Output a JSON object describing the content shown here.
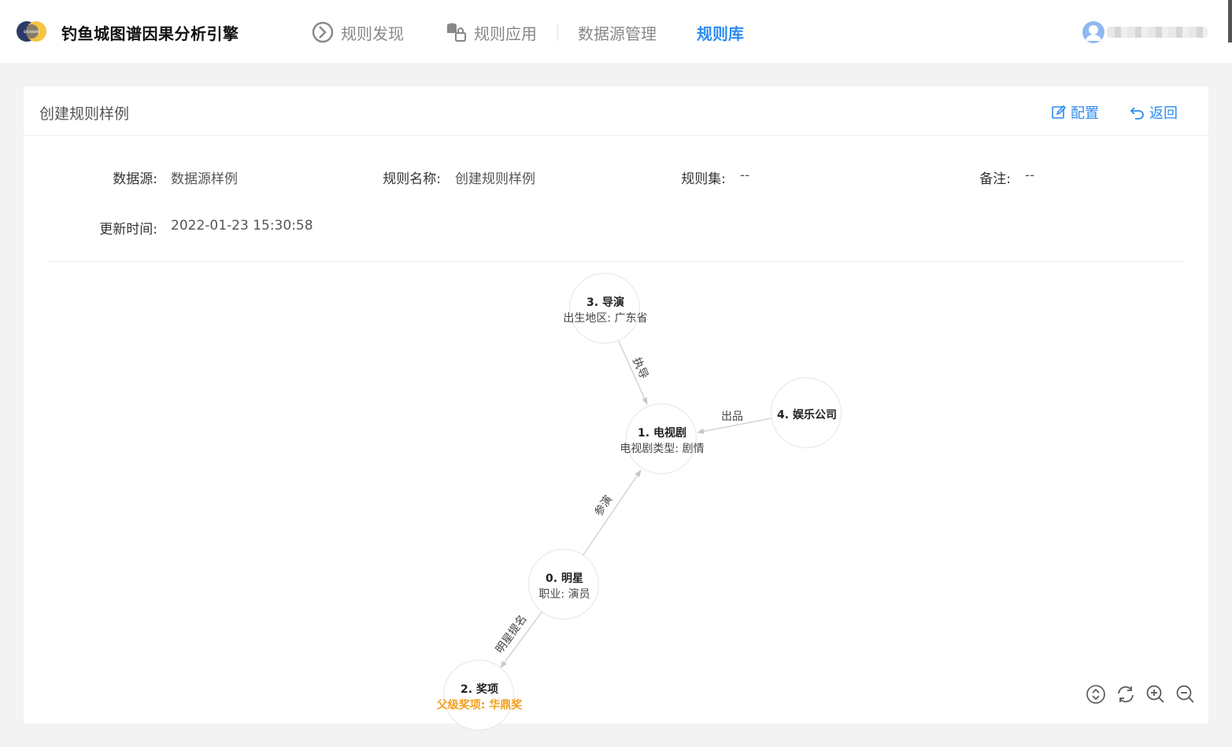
{
  "app": {
    "title": "钓鱼城图谱因果分析引擎",
    "logo_icon": "shenwan-logo"
  },
  "nav": {
    "items": [
      {
        "label": "规则发现",
        "icon": "play-circle-icon",
        "active": false
      },
      {
        "label": "规则应用",
        "icon": "database-lock-icon",
        "active": false
      },
      {
        "label": "数据源管理",
        "active": false
      },
      {
        "label": "规则库",
        "active": true
      }
    ]
  },
  "colors": {
    "accent": "#2d8cf0",
    "warn": "#f0a020"
  },
  "page": {
    "title": "创建规则样例",
    "config_label": "配置",
    "back_label": "返回"
  },
  "info": {
    "datasource_label": "数据源:",
    "datasource_value": "数据源样例",
    "rule_name_label": "规则名称:",
    "rule_name_value": "创建规则样例",
    "rule_set_label": "规则集:",
    "rule_set_value": "--",
    "note_label": "备注:",
    "note_value": "--",
    "updated_label": "更新时间:",
    "updated_value": "2022-01-23 15:30:58"
  },
  "graph": {
    "nodes": [
      {
        "title": "3. 导演",
        "attr": "出生地区: 广东省"
      },
      {
        "title": "1. 电视剧",
        "attr": "电视剧类型: 剧情"
      },
      {
        "title": "4. 娱乐公司",
        "attr": ""
      },
      {
        "title": "0. 明星",
        "attr": "职业: 演员"
      },
      {
        "title": "2. 奖项",
        "attr": "父级奖项: 华鼎奖"
      }
    ],
    "edges": [
      {
        "from": "3. 导演",
        "to": "1. 电视剧",
        "label": "执导"
      },
      {
        "from": "4. 娱乐公司",
        "to": "1. 电视剧",
        "label": "出品"
      },
      {
        "from": "0. 明星",
        "to": "1. 电视剧",
        "label": "参演"
      },
      {
        "from": "0. 明星",
        "to": "2. 奖项",
        "label": "明星提名"
      }
    ]
  },
  "toolbar": {
    "icons": [
      "fit-view-icon",
      "refresh-icon",
      "zoom-in-icon",
      "zoom-out-icon"
    ]
  }
}
